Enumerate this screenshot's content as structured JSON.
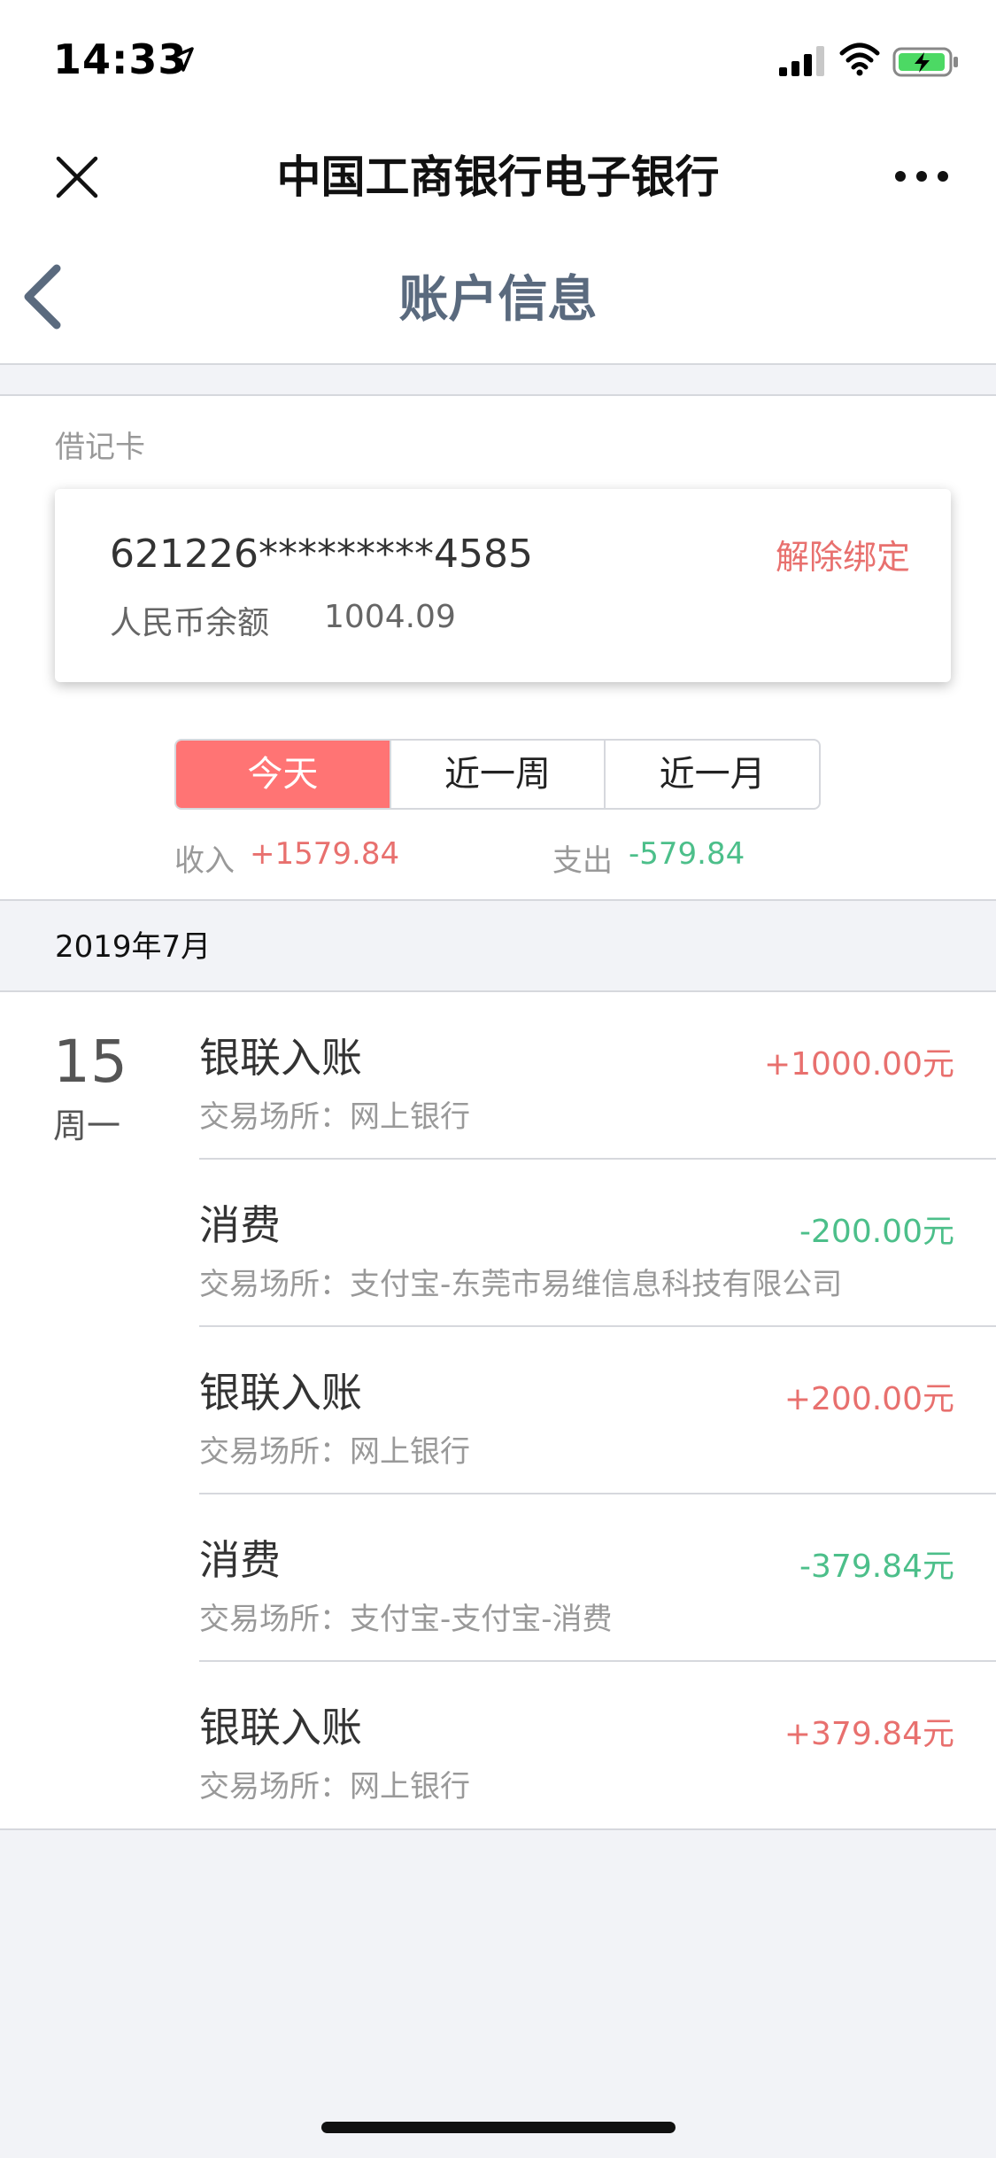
{
  "status_bar": {
    "time": "14:33",
    "icons": [
      "location-arrow-icon",
      "signal-icon",
      "wifi-icon",
      "battery-charging-icon"
    ]
  },
  "wechat_nav": {
    "title": "中国工商银行电子银行",
    "close_icon": "close-icon",
    "more_icon": "more-icon"
  },
  "page_nav": {
    "title": "账户信息",
    "back_icon": "chevron-left-icon"
  },
  "card": {
    "type_label": "借记卡",
    "number": "621226*********4585",
    "unbind_label": "解除绑定",
    "balance_label": "人民币余额",
    "balance_value": "1004.09"
  },
  "period_tabs": {
    "items": [
      {
        "label": "今天",
        "active": true
      },
      {
        "label": "近一周",
        "active": false
      },
      {
        "label": "近一月",
        "active": false
      }
    ]
  },
  "totals": {
    "income_label": "收入",
    "income_value": "+1579.84",
    "expense_label": "支出",
    "expense_value": "-579.84"
  },
  "month": {
    "label": "2019年7月"
  },
  "day_group": {
    "day": "15",
    "weekday": "周一",
    "transactions": [
      {
        "title": "银联入账",
        "place": "交易场所：网上银行",
        "amount": "+1000.00元",
        "kind": "income"
      },
      {
        "title": "消费",
        "place": "交易场所：支付宝-东莞市易维信息科技有限公司",
        "amount": "-200.00元",
        "kind": "expense"
      },
      {
        "title": "银联入账",
        "place": "交易场所：网上银行",
        "amount": "+200.00元",
        "kind": "income"
      },
      {
        "title": "消费",
        "place": "交易场所：支付宝-支付宝-消费",
        "amount": "-379.84元",
        "kind": "expense"
      },
      {
        "title": "银联入账",
        "place": "交易场所：网上银行",
        "amount": "+379.84元",
        "kind": "income"
      }
    ]
  },
  "colors": {
    "accent_red": "#ff7474",
    "income": "#e8706e",
    "expense": "#4cbf8a",
    "title_blue_gray": "#5a6a7e"
  }
}
